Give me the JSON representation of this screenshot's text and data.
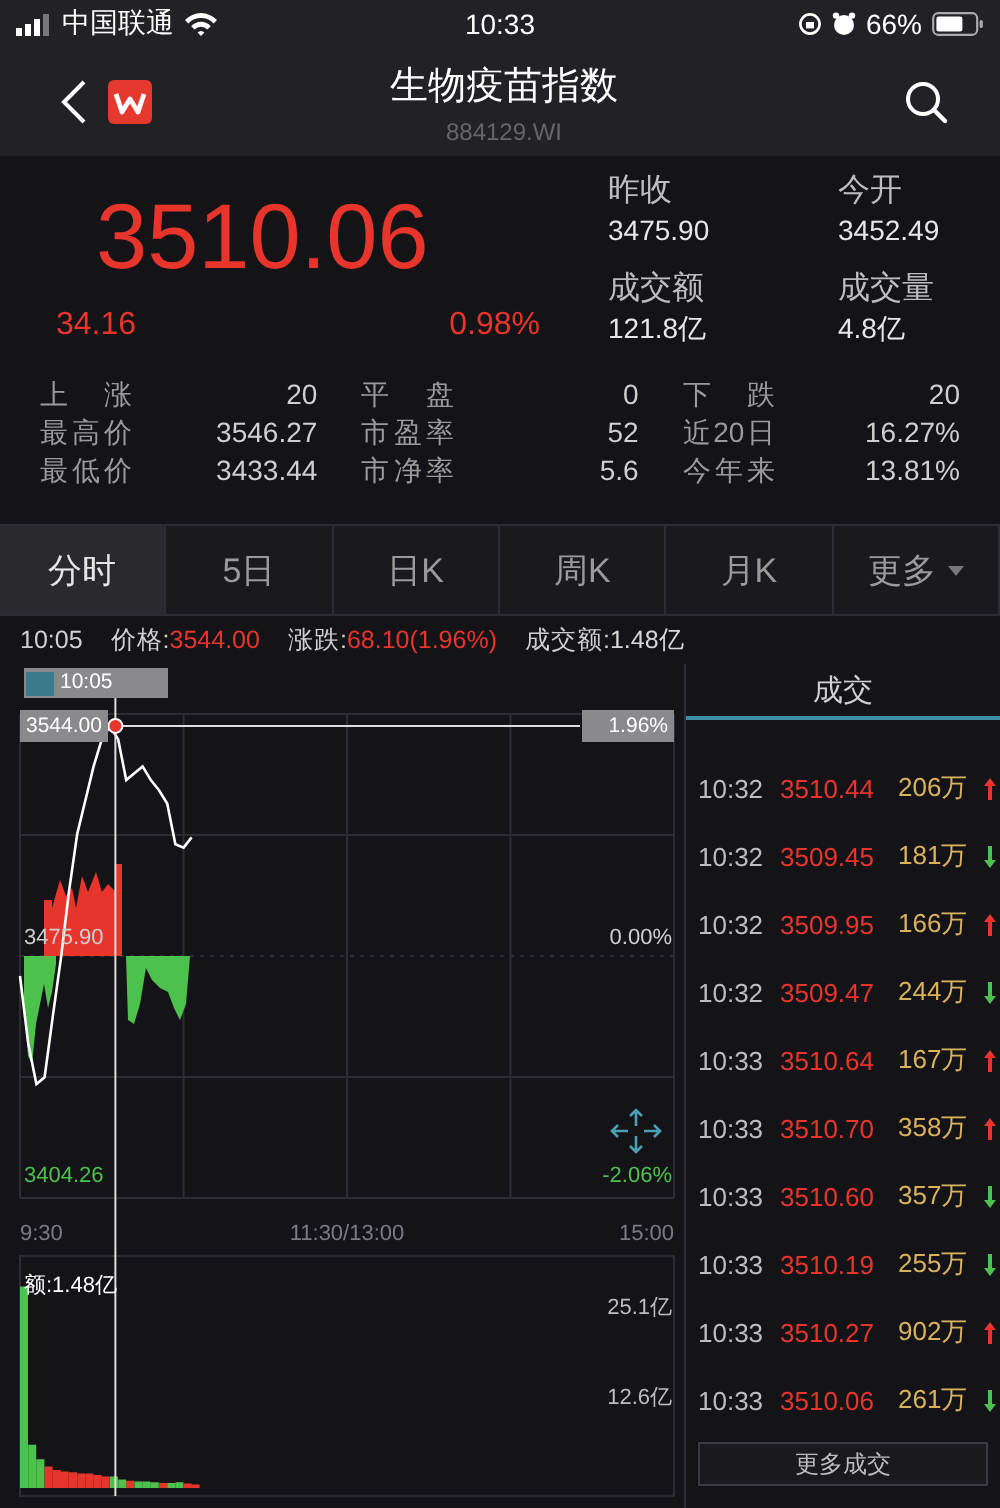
{
  "status_bar": {
    "carrier": "中国联通",
    "time": "10:33",
    "battery": "66%"
  },
  "header": {
    "title": "生物疫苗指数",
    "code": "884129.WI"
  },
  "quote": {
    "price": "3510.06",
    "change": "34.16",
    "change_pct": "0.98%",
    "fields": [
      {
        "label": "昨收",
        "value": "3475.90"
      },
      {
        "label": "今开",
        "value": "3452.49"
      },
      {
        "label": "成交额",
        "value": "121.8亿"
      },
      {
        "label": "成交量",
        "value": "4.8亿"
      }
    ]
  },
  "stats": [
    {
      "label": "上 涨",
      "value": "20"
    },
    {
      "label": "平 盘",
      "value": "0"
    },
    {
      "label": "下 跌",
      "value": "20"
    },
    {
      "label": "最高价",
      "value": "3546.27"
    },
    {
      "label": "市盈率",
      "value": "52"
    },
    {
      "label": "近20日",
      "value": "16.27%"
    },
    {
      "label": "最低价",
      "value": "3433.44"
    },
    {
      "label": "市净率",
      "value": "5.6"
    },
    {
      "label": "今年来",
      "value": "13.81%"
    }
  ],
  "tabs": [
    {
      "label": "分时",
      "selected": true
    },
    {
      "label": "5日",
      "selected": false
    },
    {
      "label": "日K",
      "selected": false
    },
    {
      "label": "周K",
      "selected": false
    },
    {
      "label": "月K",
      "selected": false
    },
    {
      "label": "更多",
      "selected": false,
      "kind": "dropdown"
    }
  ],
  "info": {
    "time": "10:05",
    "items": [
      {
        "label": "价格:",
        "value": "3544.00",
        "color": "#e8352c"
      },
      {
        "label": "涨跌:",
        "value": "68.10(1.96%)",
        "color": "#e8352c"
      },
      {
        "label": "成交额:",
        "value": "1.48亿",
        "color": "#d8d8d8"
      }
    ]
  },
  "crosshair": {
    "time": "10:05",
    "price": "3544.00",
    "percent": "1.96%"
  },
  "price_chart": {
    "right_labels": [
      {
        "text": "0.00%",
        "color": "#cfcfcf"
      },
      {
        "text": "-2.06%",
        "color": "#4cc24c"
      }
    ],
    "left_labels": [
      {
        "text": "3475.90",
        "color": "#cfcfcf"
      },
      {
        "text": "3404.26",
        "color": "#4cc24c"
      }
    ],
    "time_labels": [
      "9:30",
      "11:30/13:00",
      "15:00"
    ]
  },
  "volume_chart": {
    "label": "额:1.48亿",
    "right_labels": [
      "25.1亿",
      "12.6亿"
    ]
  },
  "trades": {
    "title": "成交",
    "rows": [
      {
        "time": "10:32",
        "price": "3510.44",
        "volume": "206万",
        "kind": "up"
      },
      {
        "time": "10:32",
        "price": "3509.45",
        "volume": "181万",
        "kind": "down"
      },
      {
        "time": "10:32",
        "price": "3509.95",
        "volume": "166万",
        "kind": "up"
      },
      {
        "time": "10:32",
        "price": "3509.47",
        "volume": "244万",
        "kind": "down"
      },
      {
        "time": "10:33",
        "price": "3510.64",
        "volume": "167万",
        "kind": "up"
      },
      {
        "time": "10:33",
        "price": "3510.70",
        "volume": "358万",
        "kind": "up"
      },
      {
        "time": "10:33",
        "price": "3510.60",
        "volume": "357万",
        "kind": "down"
      },
      {
        "time": "10:33",
        "price": "3510.19",
        "volume": "255万",
        "kind": "down"
      },
      {
        "time": "10:33",
        "price": "3510.27",
        "volume": "902万",
        "kind": "up"
      },
      {
        "time": "10:33",
        "price": "3510.06",
        "volume": "261万",
        "kind": "down"
      }
    ],
    "more": "更多成交"
  }
}
